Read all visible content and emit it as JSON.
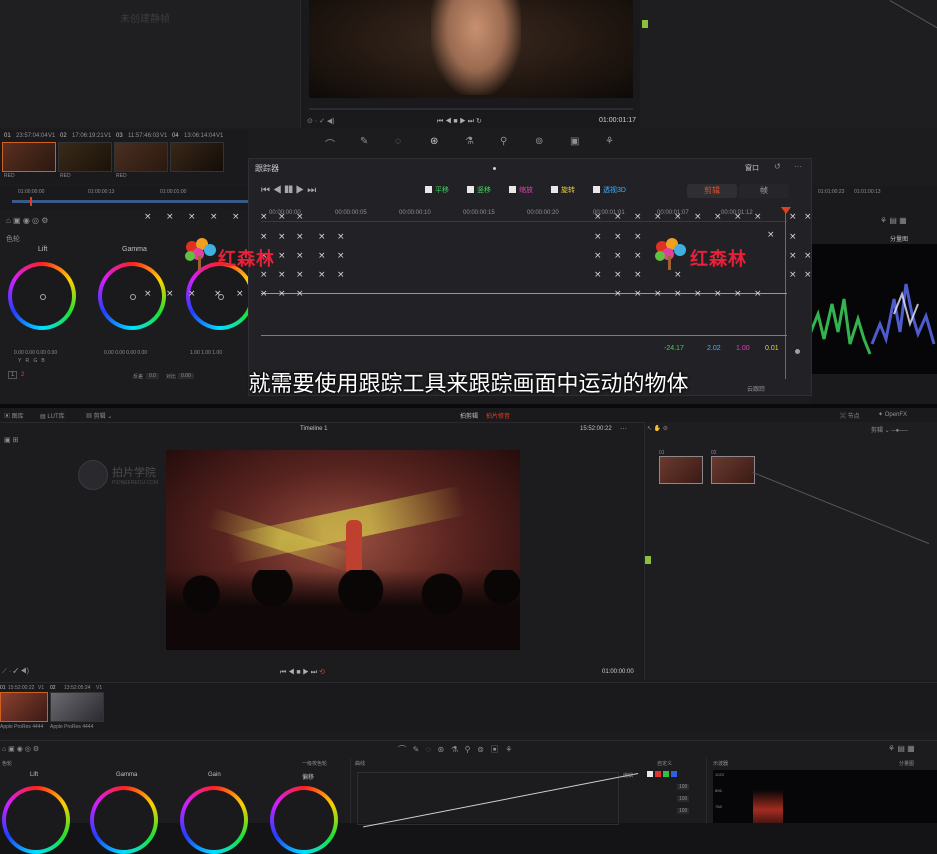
{
  "top": {
    "ghost_label": "未创建静帧",
    "viewer_timecode": "01:00:01:17",
    "clips": [
      {
        "num": "01",
        "tc": "23:57:04:04",
        "track": "V1",
        "codec": "RED"
      },
      {
        "num": "02",
        "tc": "17:06:19:21",
        "track": "V1",
        "codec": "RED"
      },
      {
        "num": "03",
        "tc": "11:57:46:03",
        "track": "V1",
        "codec": "RED"
      },
      {
        "num": "04",
        "tc": "13:06:14:04",
        "track": "V1",
        "codec": ""
      }
    ],
    "timeline_ticks": [
      "01:00:00:00",
      "01:00:00:13",
      "01:00:01:00",
      "01:00:01:13",
      "01:00:02:00",
      "01:00:02:13"
    ],
    "color_wheels": {
      "panel_label": "色轮",
      "labels": [
        "Lift",
        "Gamma"
      ],
      "lift_values": [
        "0.00",
        "0.00",
        "0.00",
        "0.00"
      ],
      "gamma_values": [
        "0.00",
        "0.00",
        "0.00",
        "0.00"
      ],
      "gain_values": [
        "1.00",
        "1.00",
        "1.00",
        "1.00"
      ],
      "channel_labels": [
        "Y",
        "R",
        "G",
        "B"
      ],
      "page_numbers": [
        "1",
        "2"
      ],
      "contrast_label": "反差",
      "contrast_value": "0.0",
      "pivot_label": "对比",
      "pivot_value": "0.00"
    },
    "scope_label": "分量图"
  },
  "tracker": {
    "title": "跟踪器",
    "window_menu": "窗口",
    "options": [
      {
        "label": "平移",
        "color": "#40d060"
      },
      {
        "label": "竖移",
        "color": "#40d060"
      },
      {
        "label": "缩放",
        "color": "#e040b0"
      },
      {
        "label": "旋转",
        "color": "#e8d040"
      },
      {
        "label": "透视3D",
        "color": "#40b0ff"
      }
    ],
    "mode_active": "剪辑",
    "mode_inactive": "帧",
    "ruler": [
      "00:00:00:00",
      "00:00:00:05",
      "00:00:00:10",
      "00:00:00:15",
      "00:00:00:20",
      "00:00:01:01",
      "00:00:01:07",
      "00:00:01:12"
    ],
    "values": [
      {
        "v": "-24.17",
        "color": "#40d060"
      },
      {
        "v": "2.02",
        "color": "#40b0ff"
      },
      {
        "v": "1.00",
        "color": "#e040b0"
      },
      {
        "v": "0.01",
        "color": "#e8d040"
      }
    ],
    "subtitle": "就需要使用跟踪工具来跟踪画面中运动的物体",
    "cloud_label": "云跟踪"
  },
  "logo_text": "红森林",
  "bottom": {
    "tabs": [
      "图库",
      "LUT库"
    ],
    "clip_menu": "剪辑",
    "window_title": "拍剪辑",
    "window_subtitle": "拍片修音",
    "nodes_label": "节点",
    "openfx_label": "OpenFX",
    "timeline_name": "Timeline 1",
    "timeline_tc": "15:52:00:22",
    "viewer_tc": "01:00:00:00",
    "watermark": "拍片学院",
    "watermark_sub": "PIONEEREDU.COM",
    "node_labels": [
      "01",
      "02"
    ],
    "clips": [
      {
        "num": "01",
        "tc": "15:52:00:22",
        "track": "V1",
        "codec": "Apple ProRes 4444"
      },
      {
        "num": "02",
        "tc": "13:52:05:24",
        "track": "V1",
        "codec": "Apple ProRes 4444"
      }
    ],
    "wheels_label": "色轮",
    "wheels_mode": "一级校色轮",
    "wheel_labels": [
      "Lift",
      "Gamma",
      "Gain",
      "偏移"
    ],
    "curves_label": "曲线",
    "custom_label": "自定义",
    "edit_label": "编辑",
    "curve_values": [
      "100",
      "100",
      "100"
    ],
    "scope_title": "示波器",
    "scope_mode": "分量图",
    "scope_ticks": [
      "1023",
      "896",
      "768"
    ]
  }
}
